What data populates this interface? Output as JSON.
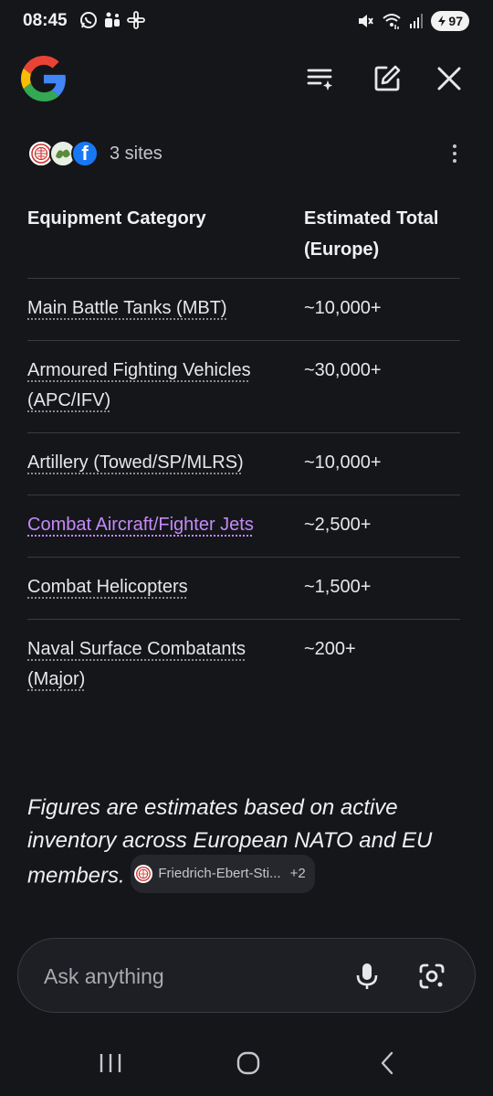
{
  "status_bar": {
    "time": "08:45",
    "battery": "97",
    "left_icons": [
      "whatsapp-icon",
      "teams-icon",
      "slack-icon"
    ],
    "right_icons": [
      "mute-icon",
      "wifi-icon",
      "signal-icon",
      "battery-icon"
    ]
  },
  "header": {
    "logo": "google-g-logo",
    "icons": [
      "history-icon",
      "edit-icon",
      "close-icon"
    ]
  },
  "sources": {
    "label": "3 sites",
    "favicons": [
      "fes-favicon",
      "green-site-favicon",
      "facebook-favicon"
    ],
    "facebook_letter": "f"
  },
  "table": {
    "headers": [
      "Equipment Category",
      "Estimated Total (Europe)"
    ],
    "rows": [
      {
        "category": "Main Battle Tanks (MBT)",
        "total": "~10,000+"
      },
      {
        "category": "Armoured Fighting Vehicles (APC/IFV)",
        "total": "~30,000+"
      },
      {
        "category": "Artillery (Towed/SP/MLRS)",
        "total": "~10,000+"
      },
      {
        "category": "Combat Aircraft/Fighter Jets",
        "total": "~2,500+"
      },
      {
        "category": "Combat Helicopters",
        "total": "~1,500+"
      },
      {
        "category": "Naval Surface Combatants (Major)",
        "total": "~200+"
      }
    ]
  },
  "footnote": {
    "text": "Figures are estimates based on active inventory across European NATO and EU members.",
    "chip_label": "Friedrich-Ebert-Sti...",
    "chip_more": "+2"
  },
  "ask_bar": {
    "placeholder": "Ask anything"
  },
  "colors": {
    "background": "#15161a",
    "visited_link": "#c58af9",
    "google_blue": "#4285F4",
    "google_red": "#EA4335",
    "google_yellow": "#FBBC05",
    "google_green": "#34A853"
  }
}
